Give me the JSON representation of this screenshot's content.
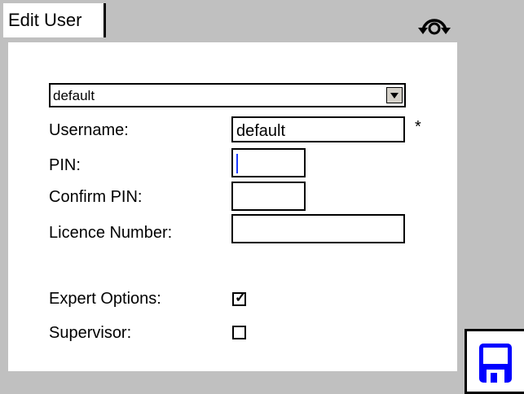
{
  "header": {
    "tab_label": "Edit User",
    "sync_icon": "sync-icon"
  },
  "form": {
    "user_select": {
      "value": "default"
    },
    "username": {
      "label": "Username:",
      "value": "default",
      "required_marker": "*"
    },
    "pin": {
      "label": "PIN:",
      "value": ""
    },
    "confirm_pin": {
      "label": "Confirm PIN:",
      "value": ""
    },
    "licence_number": {
      "label": "Licence Number:",
      "value": ""
    },
    "expert_options": {
      "label": "Expert Options:",
      "checked": true
    },
    "supervisor": {
      "label": "Supervisor:",
      "checked": false
    }
  },
  "toolbar": {
    "save_icon": "floppy-disk-icon",
    "accent": "#0000ff"
  },
  "colors": {
    "background": "#c0c0c0",
    "panel": "#ffffff",
    "caret": "#1a3aff"
  }
}
